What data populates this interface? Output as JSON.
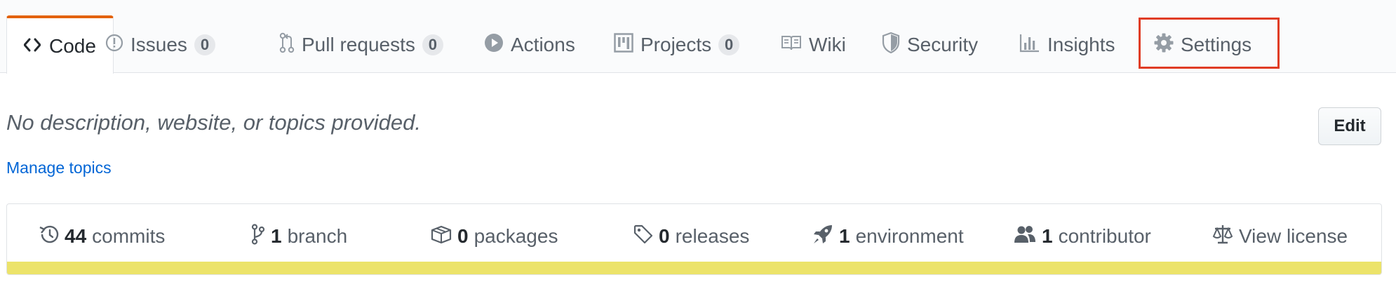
{
  "tabs": [
    {
      "id": "code",
      "label": "Code",
      "icon": "code-icon",
      "selected": true
    },
    {
      "id": "issues",
      "label": "Issues",
      "icon": "issue-opened-icon",
      "count": "0"
    },
    {
      "id": "pulls",
      "label": "Pull requests",
      "icon": "git-pull-request-icon",
      "count": "0"
    },
    {
      "id": "actions",
      "label": "Actions",
      "icon": "play-icon"
    },
    {
      "id": "projects",
      "label": "Projects",
      "icon": "project-icon",
      "count": "0"
    },
    {
      "id": "wiki",
      "label": "Wiki",
      "icon": "book-icon"
    },
    {
      "id": "security",
      "label": "Security",
      "icon": "shield-icon"
    },
    {
      "id": "insights",
      "label": "Insights",
      "icon": "graph-icon"
    },
    {
      "id": "settings",
      "label": "Settings",
      "icon": "gear-icon",
      "highlighted": true
    }
  ],
  "repo": {
    "description": "No description, website, or topics provided.",
    "edit_label": "Edit",
    "manage_topics": "Manage topics"
  },
  "summary": [
    {
      "icon": "history-icon",
      "count": "44",
      "label": "commits"
    },
    {
      "icon": "git-branch-icon",
      "count": "1",
      "label": "branch"
    },
    {
      "icon": "package-icon",
      "count": "0",
      "label": "packages"
    },
    {
      "icon": "tag-icon",
      "count": "0",
      "label": "releases"
    },
    {
      "icon": "rocket-icon",
      "count": "1",
      "label": "environment"
    },
    {
      "icon": "people-icon",
      "count": "1",
      "label": "contributor"
    },
    {
      "icon": "law-icon",
      "count": "",
      "label": "View license"
    }
  ],
  "colors": {
    "tab_accent": "#e36209",
    "highlight_box": "#e03c25",
    "link": "#0366d6",
    "language_bar": "#ece36a"
  }
}
